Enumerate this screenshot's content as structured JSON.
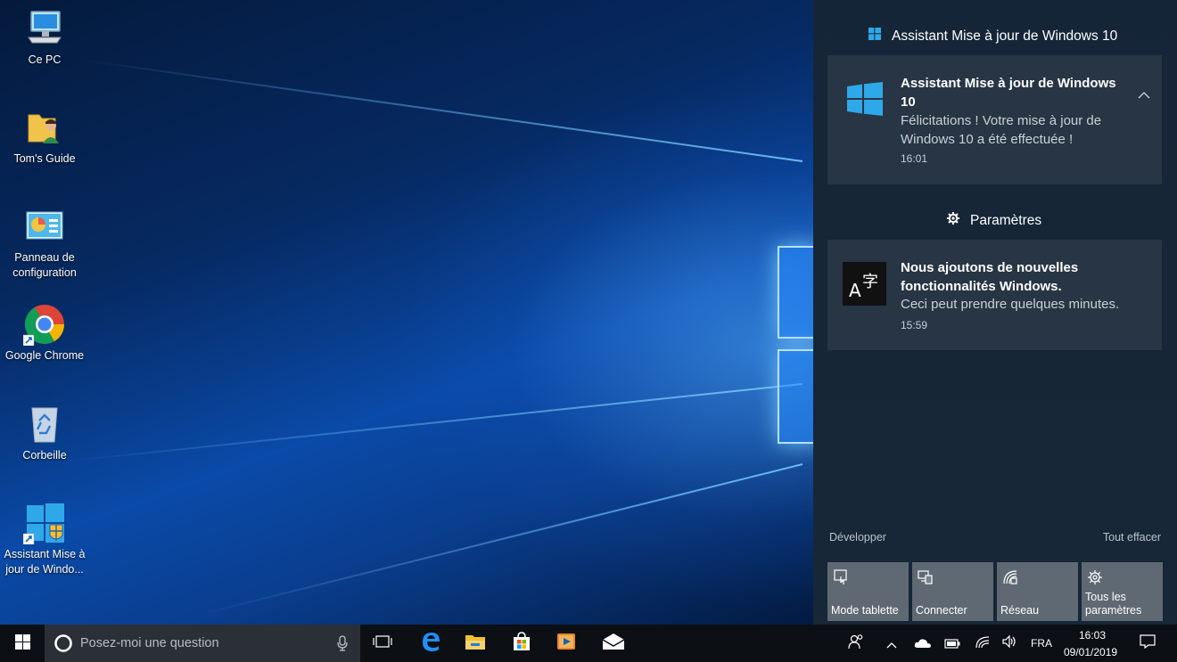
{
  "desktop": {
    "icons": [
      {
        "label": "Ce PC",
        "icon": "computer-icon"
      },
      {
        "label": "Tom's Guide",
        "icon": "user-folder-icon"
      },
      {
        "label": "Panneau de configuration",
        "icon": "control-panel-icon"
      },
      {
        "label": "Google Chrome",
        "icon": "chrome-icon"
      },
      {
        "label": "Corbeille",
        "icon": "recycle-bin-icon"
      },
      {
        "label": "Assistant Mise à jour de Windo...",
        "icon": "windows-update-assistant-icon"
      }
    ]
  },
  "action_center": {
    "groups": [
      {
        "header": "Assistant Mise à jour de Windows 10",
        "icon": "windows-logo-icon",
        "notification": {
          "title": "Assistant Mise à jour de Windows 10",
          "body": "Félicitations ! Votre mise à jour de Windows 10 a été effectuée !",
          "time": "16:01"
        }
      },
      {
        "header": "Paramètres",
        "icon": "gear-icon",
        "notification": {
          "title": "Nous ajoutons de nouvelles fonctionnalités Windows.",
          "body": "Ceci peut prendre quelques minutes.",
          "time": "15:59"
        }
      }
    ],
    "expand_label": "Développer",
    "clear_all_label": "Tout effacer",
    "quick_actions": [
      {
        "label": "Mode tablette",
        "icon": "tablet-mode-icon"
      },
      {
        "label": "Connecter",
        "icon": "connect-icon"
      },
      {
        "label": "Réseau",
        "icon": "network-icon"
      },
      {
        "label": "Tous les paramètres",
        "icon": "settings-gear-icon"
      }
    ]
  },
  "taskbar": {
    "search_placeholder": "Posez-moi une question",
    "apps": [
      "task-view-icon",
      "edge-icon",
      "file-explorer-icon",
      "store-icon",
      "media-player-icon",
      "mail-icon"
    ],
    "tray": {
      "language": "FRA",
      "time": "16:03",
      "date": "09/01/2019"
    }
  },
  "colors": {
    "accent": "#1e90ff",
    "action_center_bg": "#17283a",
    "card_bg": "#283644",
    "tile_bg": "#7a8088",
    "taskbar_bg": "#0c0f14"
  }
}
